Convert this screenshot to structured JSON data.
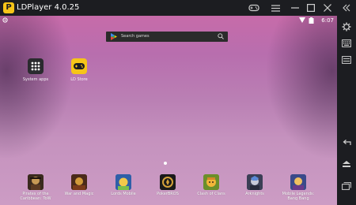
{
  "window": {
    "title": "LDPlayer 4.0.25",
    "logo_letter": "P"
  },
  "titlebar": {
    "icons": [
      "gamepad-icon",
      "menu-icon",
      "minimize-icon",
      "maximize-icon",
      "close-icon",
      "collapse-sidebar-icon"
    ]
  },
  "statusbar": {
    "time": "6:07",
    "icons": [
      "settings-small-icon",
      "wifi-icon",
      "battery-icon"
    ]
  },
  "search": {
    "placeholder": "Search games",
    "icons": [
      "play-store-icon",
      "search-icon"
    ]
  },
  "desktop_apps": [
    {
      "label": "System apps",
      "icon": "grid-apps-icon",
      "color": "#2a2a2e"
    },
    {
      "label": "LD Store",
      "icon": "gamepad-store-icon",
      "color": "#f6c518"
    }
  ],
  "dock_apps": [
    {
      "label": "Pirates of the Caribbean: ToW",
      "color": "#3a2a1e",
      "accent": "#c79a55"
    },
    {
      "label": "War and Magic",
      "color": "#4a2a1a",
      "accent": "#d29a3a"
    },
    {
      "label": "Lords Mobile",
      "color": "#2f5fa8",
      "accent": "#f3c94a"
    },
    {
      "label": "PokerBROS",
      "color": "#1a1a1a",
      "accent": "#d4a23a"
    },
    {
      "label": "Clash of Clans",
      "color": "#6b8f2a",
      "accent": "#f2b638"
    },
    {
      "label": "Arknights",
      "color": "#3b3f55",
      "accent": "#c7c9d8"
    },
    {
      "label": "Mobile Legends: Bang Bang",
      "color": "#3a4a8a",
      "accent": "#f0c060"
    }
  ],
  "sidebar": {
    "icons": [
      "settings-icon",
      "keyboard-icon",
      "toolbar-icon",
      "back-icon",
      "home-icon",
      "recent-apps-icon"
    ]
  },
  "colors": {
    "chrome": "#1c1d21",
    "wallpaper_top": "#c76ba9",
    "wallpaper_bottom": "#cc9cc4",
    "accent_yellow": "#f6c518"
  }
}
